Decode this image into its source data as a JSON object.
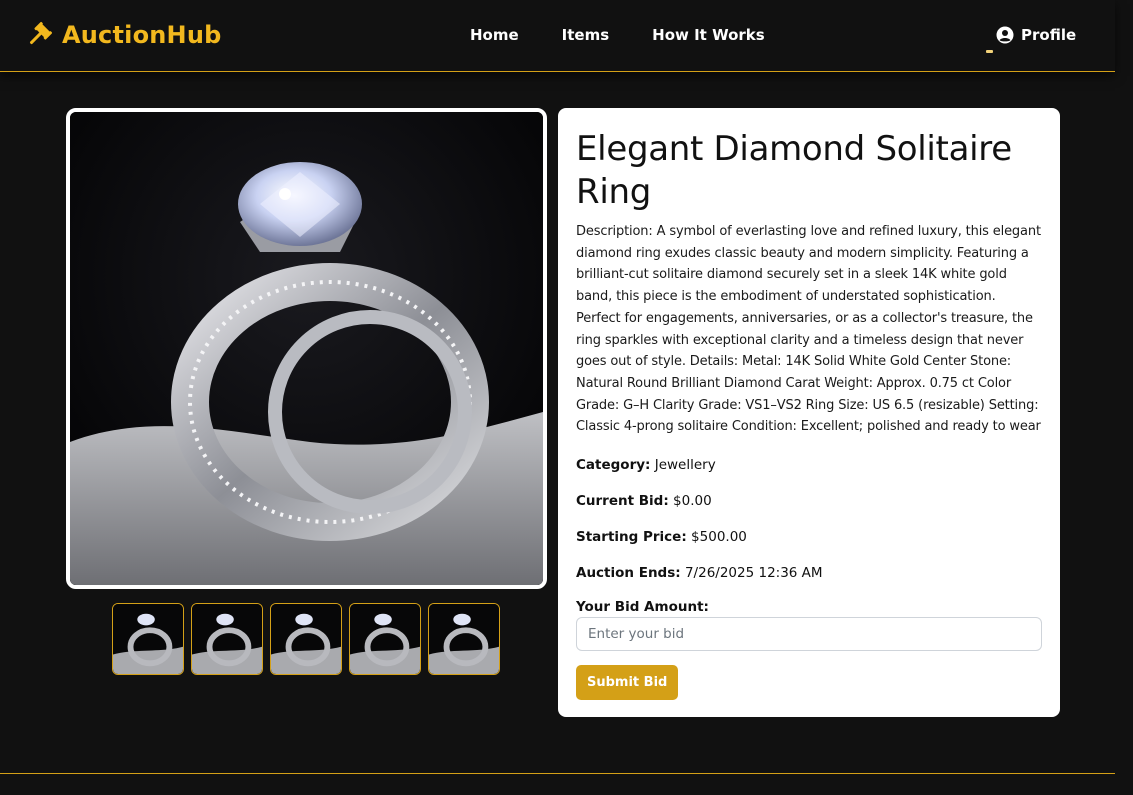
{
  "brand": {
    "name": "AuctionHub",
    "icon": "gavel-icon",
    "color": "#f2b81e"
  },
  "nav": {
    "links": [
      "Home",
      "Items",
      "How It Works"
    ],
    "profile_label": "Profile",
    "profile_icon": "user-circle-icon"
  },
  "gallery": {
    "main_image_alt": "Elegant Diamond Solitaire Ring",
    "thumbnail_count": 5
  },
  "item": {
    "title": "Elegant Diamond Solitaire Ring",
    "description": "Description: A symbol of everlasting love and refined luxury, this elegant diamond ring exudes classic beauty and modern simplicity. Featuring a brilliant-cut solitaire diamond securely set in a sleek 14K white gold band, this piece is the embodiment of understated sophistication. Perfect for engagements, anniversaries, or as a collector's treasure, the ring sparkles with exceptional clarity and a timeless design that never goes out of style. Details: Metal: 14K Solid White Gold Center Stone: Natural Round Brilliant Diamond Carat Weight: Approx. 0.75 ct Color Grade: G–H Clarity Grade: VS1–VS2 Ring Size: US 6.5 (resizable) Setting: Classic 4-prong solitaire Condition: Excellent; polished and ready to wear",
    "category_label": "Category:",
    "category": "Jewellery",
    "current_bid_label": "Current Bid:",
    "current_bid": "$0.00",
    "starting_price_label": "Starting Price:",
    "starting_price": "$500.00",
    "auction_ends_label": "Auction Ends:",
    "auction_ends": "7/26/2025 12:36 AM"
  },
  "bid_form": {
    "label": "Your Bid Amount:",
    "placeholder": "Enter your bid",
    "value": "",
    "submit_label": "Submit Bid"
  },
  "colors": {
    "background": "#111111",
    "accent": "#d4a017",
    "card": "#ffffff"
  }
}
